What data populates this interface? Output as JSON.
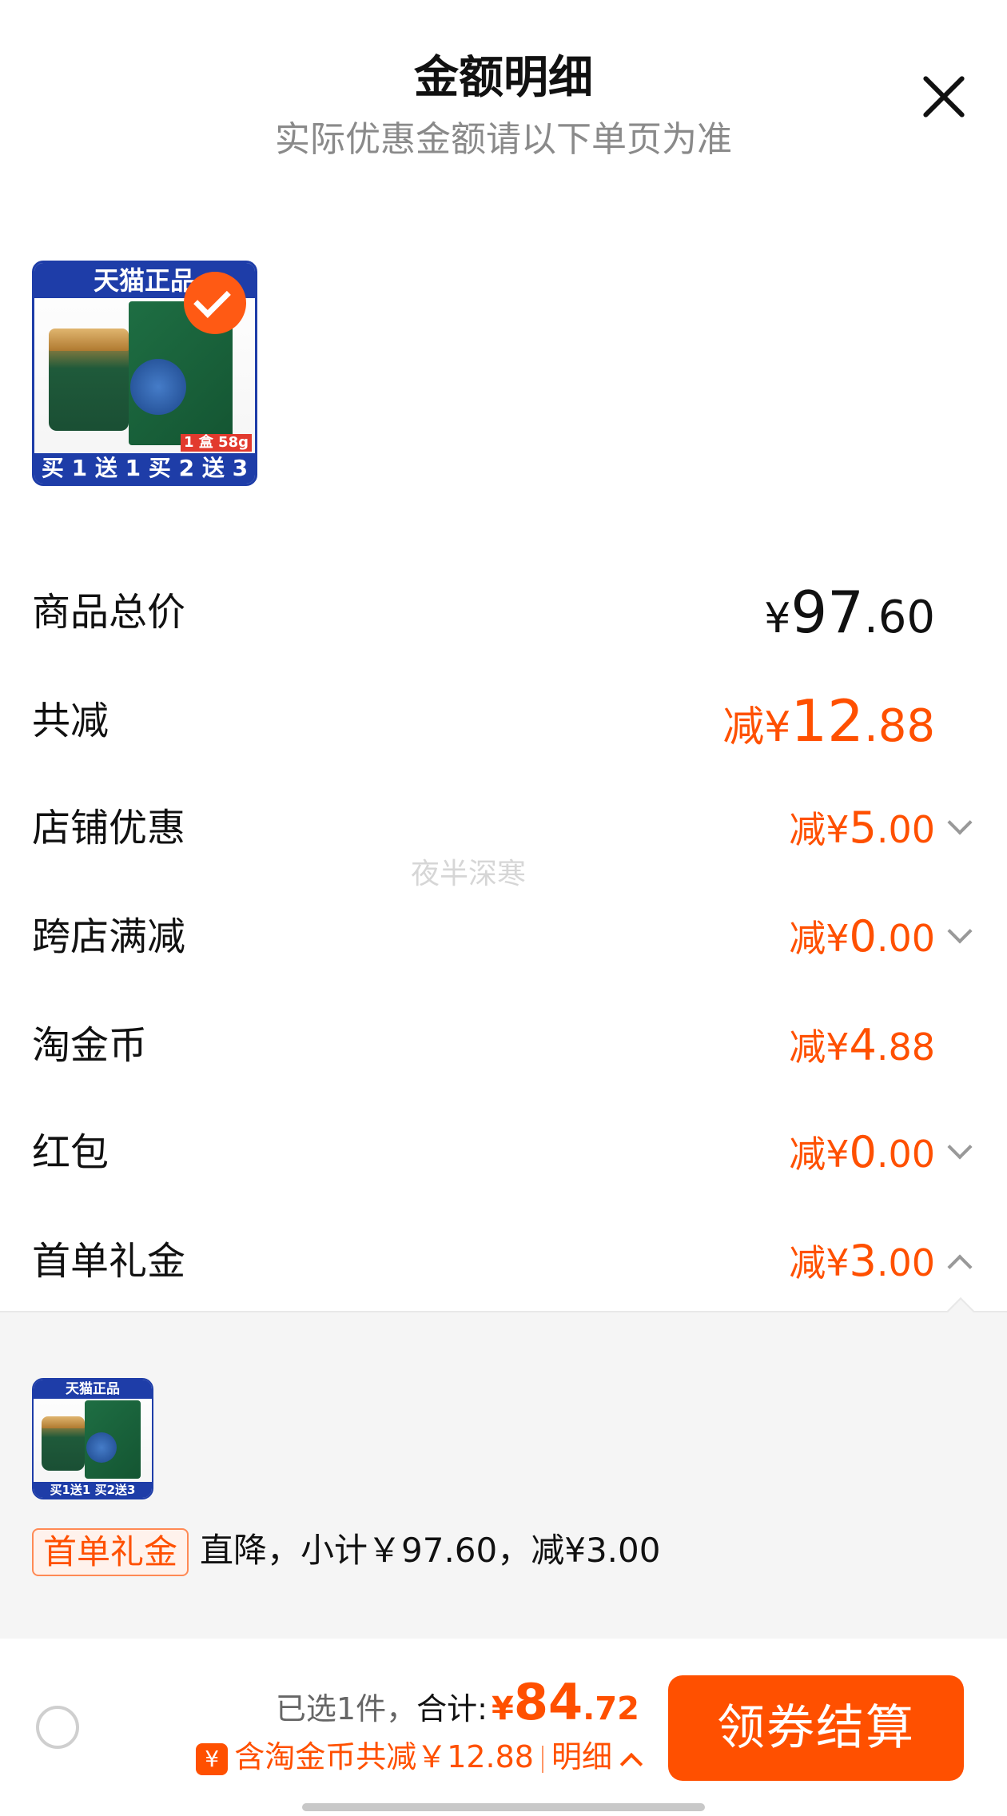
{
  "header": {
    "title": "金额明细",
    "subtitle": "实际优惠金额请以下单页为准"
  },
  "product": {
    "top_badge": "天猫正品",
    "promo_strip": "买 1 送 1 买 2 送 3",
    "weight_tag": "1 盒 58g"
  },
  "summary": {
    "total_label": "商品总价",
    "total_currency": "¥",
    "total_int": "97",
    "total_dec": ".60",
    "discount_label": "共减",
    "discount_prefix": "减¥",
    "discount_int": "12",
    "discount_dec": ".88"
  },
  "discounts": [
    {
      "label": "店铺优惠",
      "prefix": "减¥",
      "int": "5",
      "dec": ".00",
      "chevron": "down"
    },
    {
      "label": "跨店满减",
      "prefix": "减¥",
      "int": "0",
      "dec": ".00",
      "chevron": "down"
    },
    {
      "label": "淘金币",
      "prefix": "减¥",
      "int": "4",
      "dec": ".88",
      "chevron": "none"
    },
    {
      "label": "红包",
      "prefix": "减¥",
      "int": "0",
      "dec": ".00",
      "chevron": "down"
    },
    {
      "label": "首单礼金",
      "prefix": "减¥",
      "int": "3",
      "dec": ".00",
      "chevron": "up"
    }
  ],
  "expanded": {
    "thumb_top_badge": "天猫正品",
    "thumb_promo_strip": "买1送1 买2送3",
    "tag": "首单礼金",
    "description": "直降，小计￥97.60，减¥3.00"
  },
  "watermark": "夜半深寒",
  "footer": {
    "selected_count": "已选1件，",
    "total_label": "合计:",
    "total_currency": "¥",
    "total_int": "84",
    "total_dec": ".72",
    "coin_icon_text": "¥",
    "coin_text": "含淘金币共减￥12.88",
    "detail_label": "明细",
    "checkout_label": "领券结算"
  },
  "colors": {
    "accent": "#ff5000",
    "badge_blue": "#1e3da8",
    "panel_bg": "#f5f5f5"
  }
}
